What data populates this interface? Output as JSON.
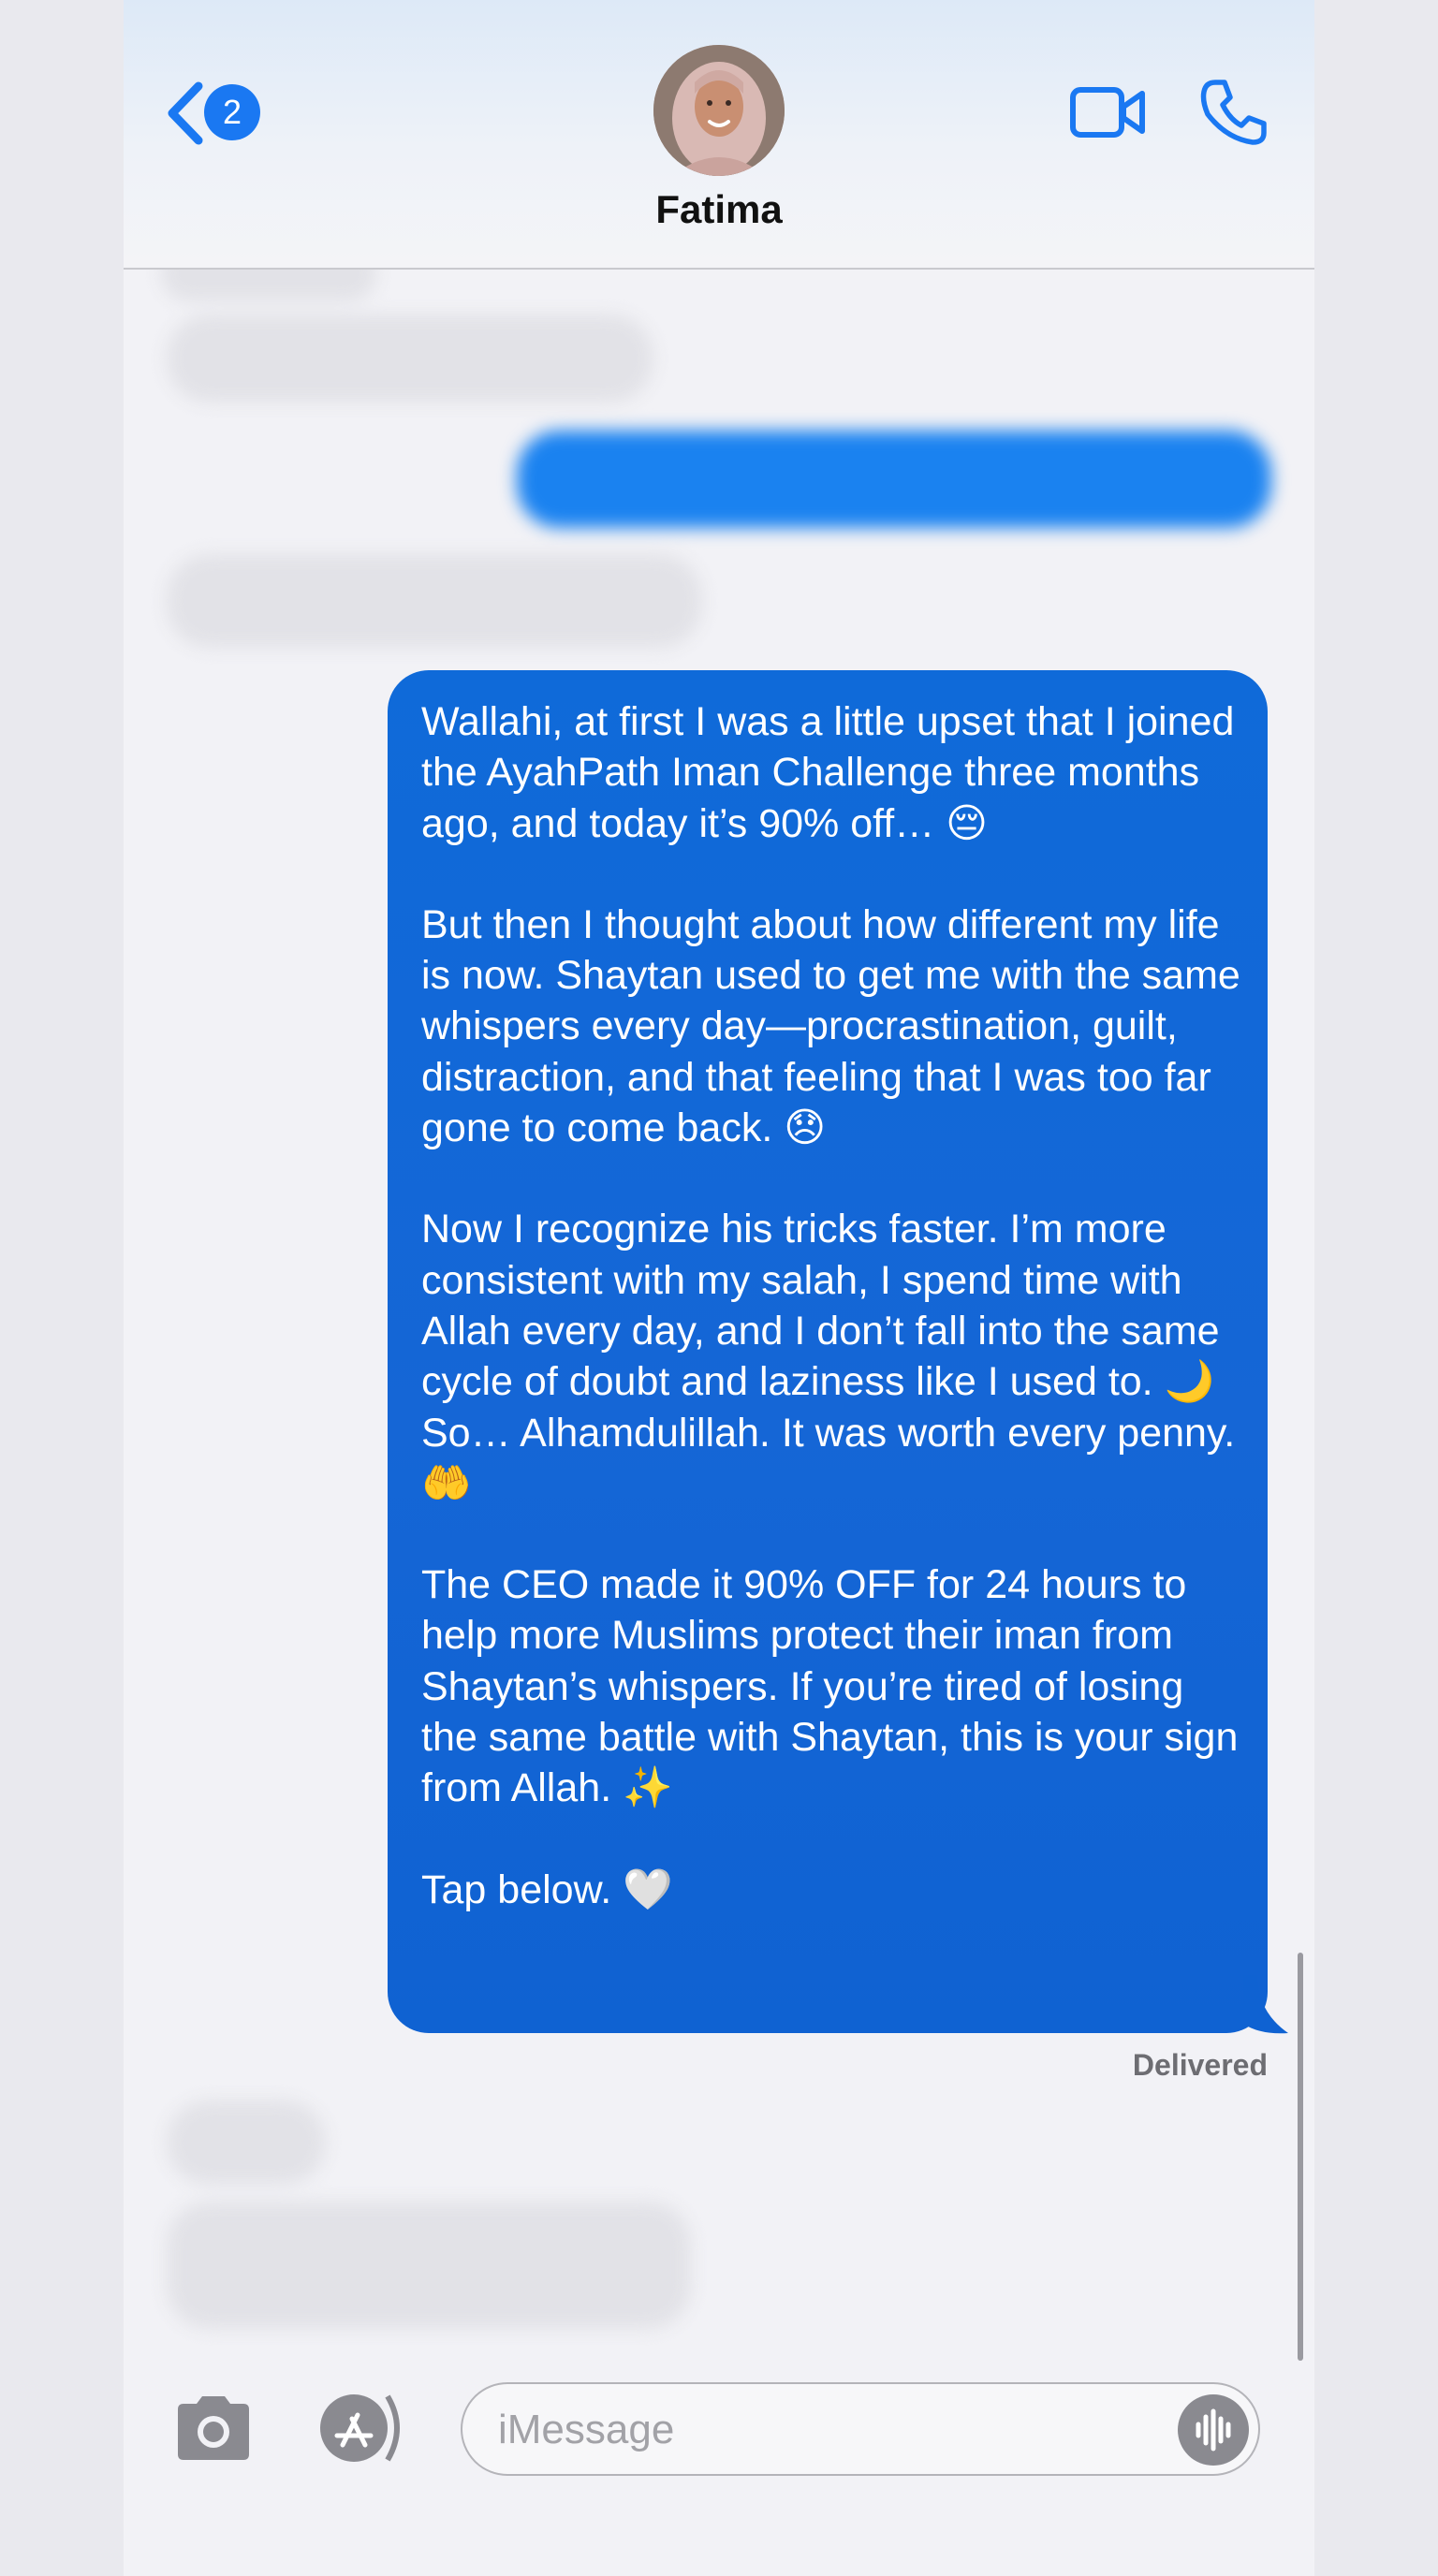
{
  "header": {
    "back_badge_count": "2",
    "contact_name": "Fatima"
  },
  "message": {
    "paragraphs": [
      "Wallahi, at first I was a little upset that I joined the AyahPath Iman Challenge three months ago, and today it’s 90% off… 😔",
      "But then I thought about how different my life is now. Shaytan used to get me with the same whispers every day—procrastination, guilt, distraction, and that feeling that I was too far gone to come back. 😞",
      "Now I recognize his tricks faster. I’m more consistent with my salah, I spend time with Allah every day, and I don’t fall into the same cycle of doubt and laziness like I used to. 🌙",
      "So… Alhamdulillah. It was worth every penny. 🤲",
      "The CEO made it 90% OFF for 24 hours to help more Muslims protect their iman from Shaytan’s whispers. If you’re tired of losing the same battle with Shaytan, this is your sign from Allah. ✨",
      "Tap below. 🤍"
    ],
    "status": "Delivered"
  },
  "composer": {
    "placeholder": "iMessage"
  },
  "colors": {
    "accent": "#1a78f2",
    "outgoing_bubble": "#1566d6",
    "incoming_bubble": "#e2e2e7"
  },
  "icons": {
    "back": "chevron-left-icon",
    "video": "video-camera-icon",
    "call": "phone-icon",
    "camera": "camera-icon",
    "apps": "app-store-icon",
    "voice": "waveform-icon"
  }
}
